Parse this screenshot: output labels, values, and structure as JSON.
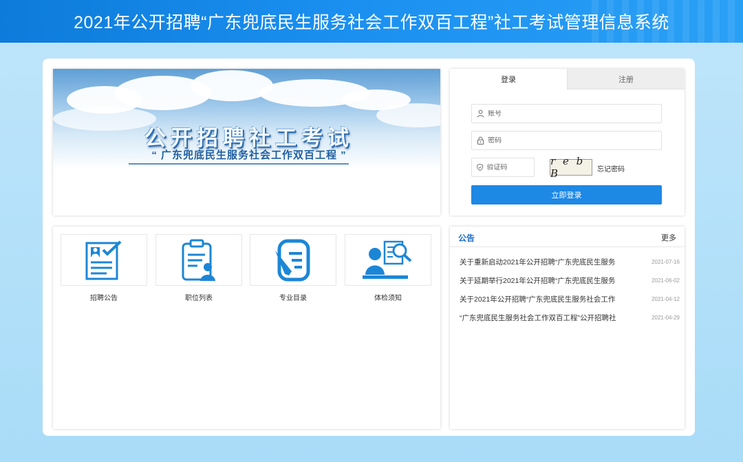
{
  "header": {
    "title": "2021年公开招聘“广东兜底民生服务社会工作双百工程”社工考试管理信息系统"
  },
  "banner": {
    "title": "公开招聘社工考试",
    "subtitle": "“ 广东兜底民生服务社会工作双百工程 ”"
  },
  "login": {
    "tabs": [
      {
        "label": "登录"
      },
      {
        "label": "注册"
      }
    ],
    "account_placeholder": "账号",
    "password_placeholder": "密码",
    "captcha_placeholder": "验证码",
    "captcha_text": "r e b B",
    "forgot_label": "忘记密码",
    "submit_label": "立即登录"
  },
  "services": [
    {
      "label": "招聘公告",
      "icon": "recruitment-notice-icon"
    },
    {
      "label": "职位列表",
      "icon": "position-list-icon"
    },
    {
      "label": "专业目录",
      "icon": "major-catalog-icon"
    },
    {
      "label": "体检须知",
      "icon": "medical-exam-icon"
    }
  ],
  "notices": {
    "title": "公告",
    "more_label": "更多",
    "items": [
      {
        "text": "关于重新启动2021年公开招聘“广东兜底民生服务",
        "date": "2021-07-16"
      },
      {
        "text": "关于延期举行2021年公开招聘“广东兜底民生服务",
        "date": "2021-06-02"
      },
      {
        "text": "关于2021年公开招聘“广东兜底民生服务社会工作",
        "date": "2021-04-12"
      },
      {
        "text": "“广东兜底民生服务社会工作双百工程”公开招聘社",
        "date": "2021-04-29"
      }
    ]
  },
  "colors": {
    "primary": "#1e88e5",
    "header": "#1a8ff0",
    "background": "#b3e0fa"
  }
}
